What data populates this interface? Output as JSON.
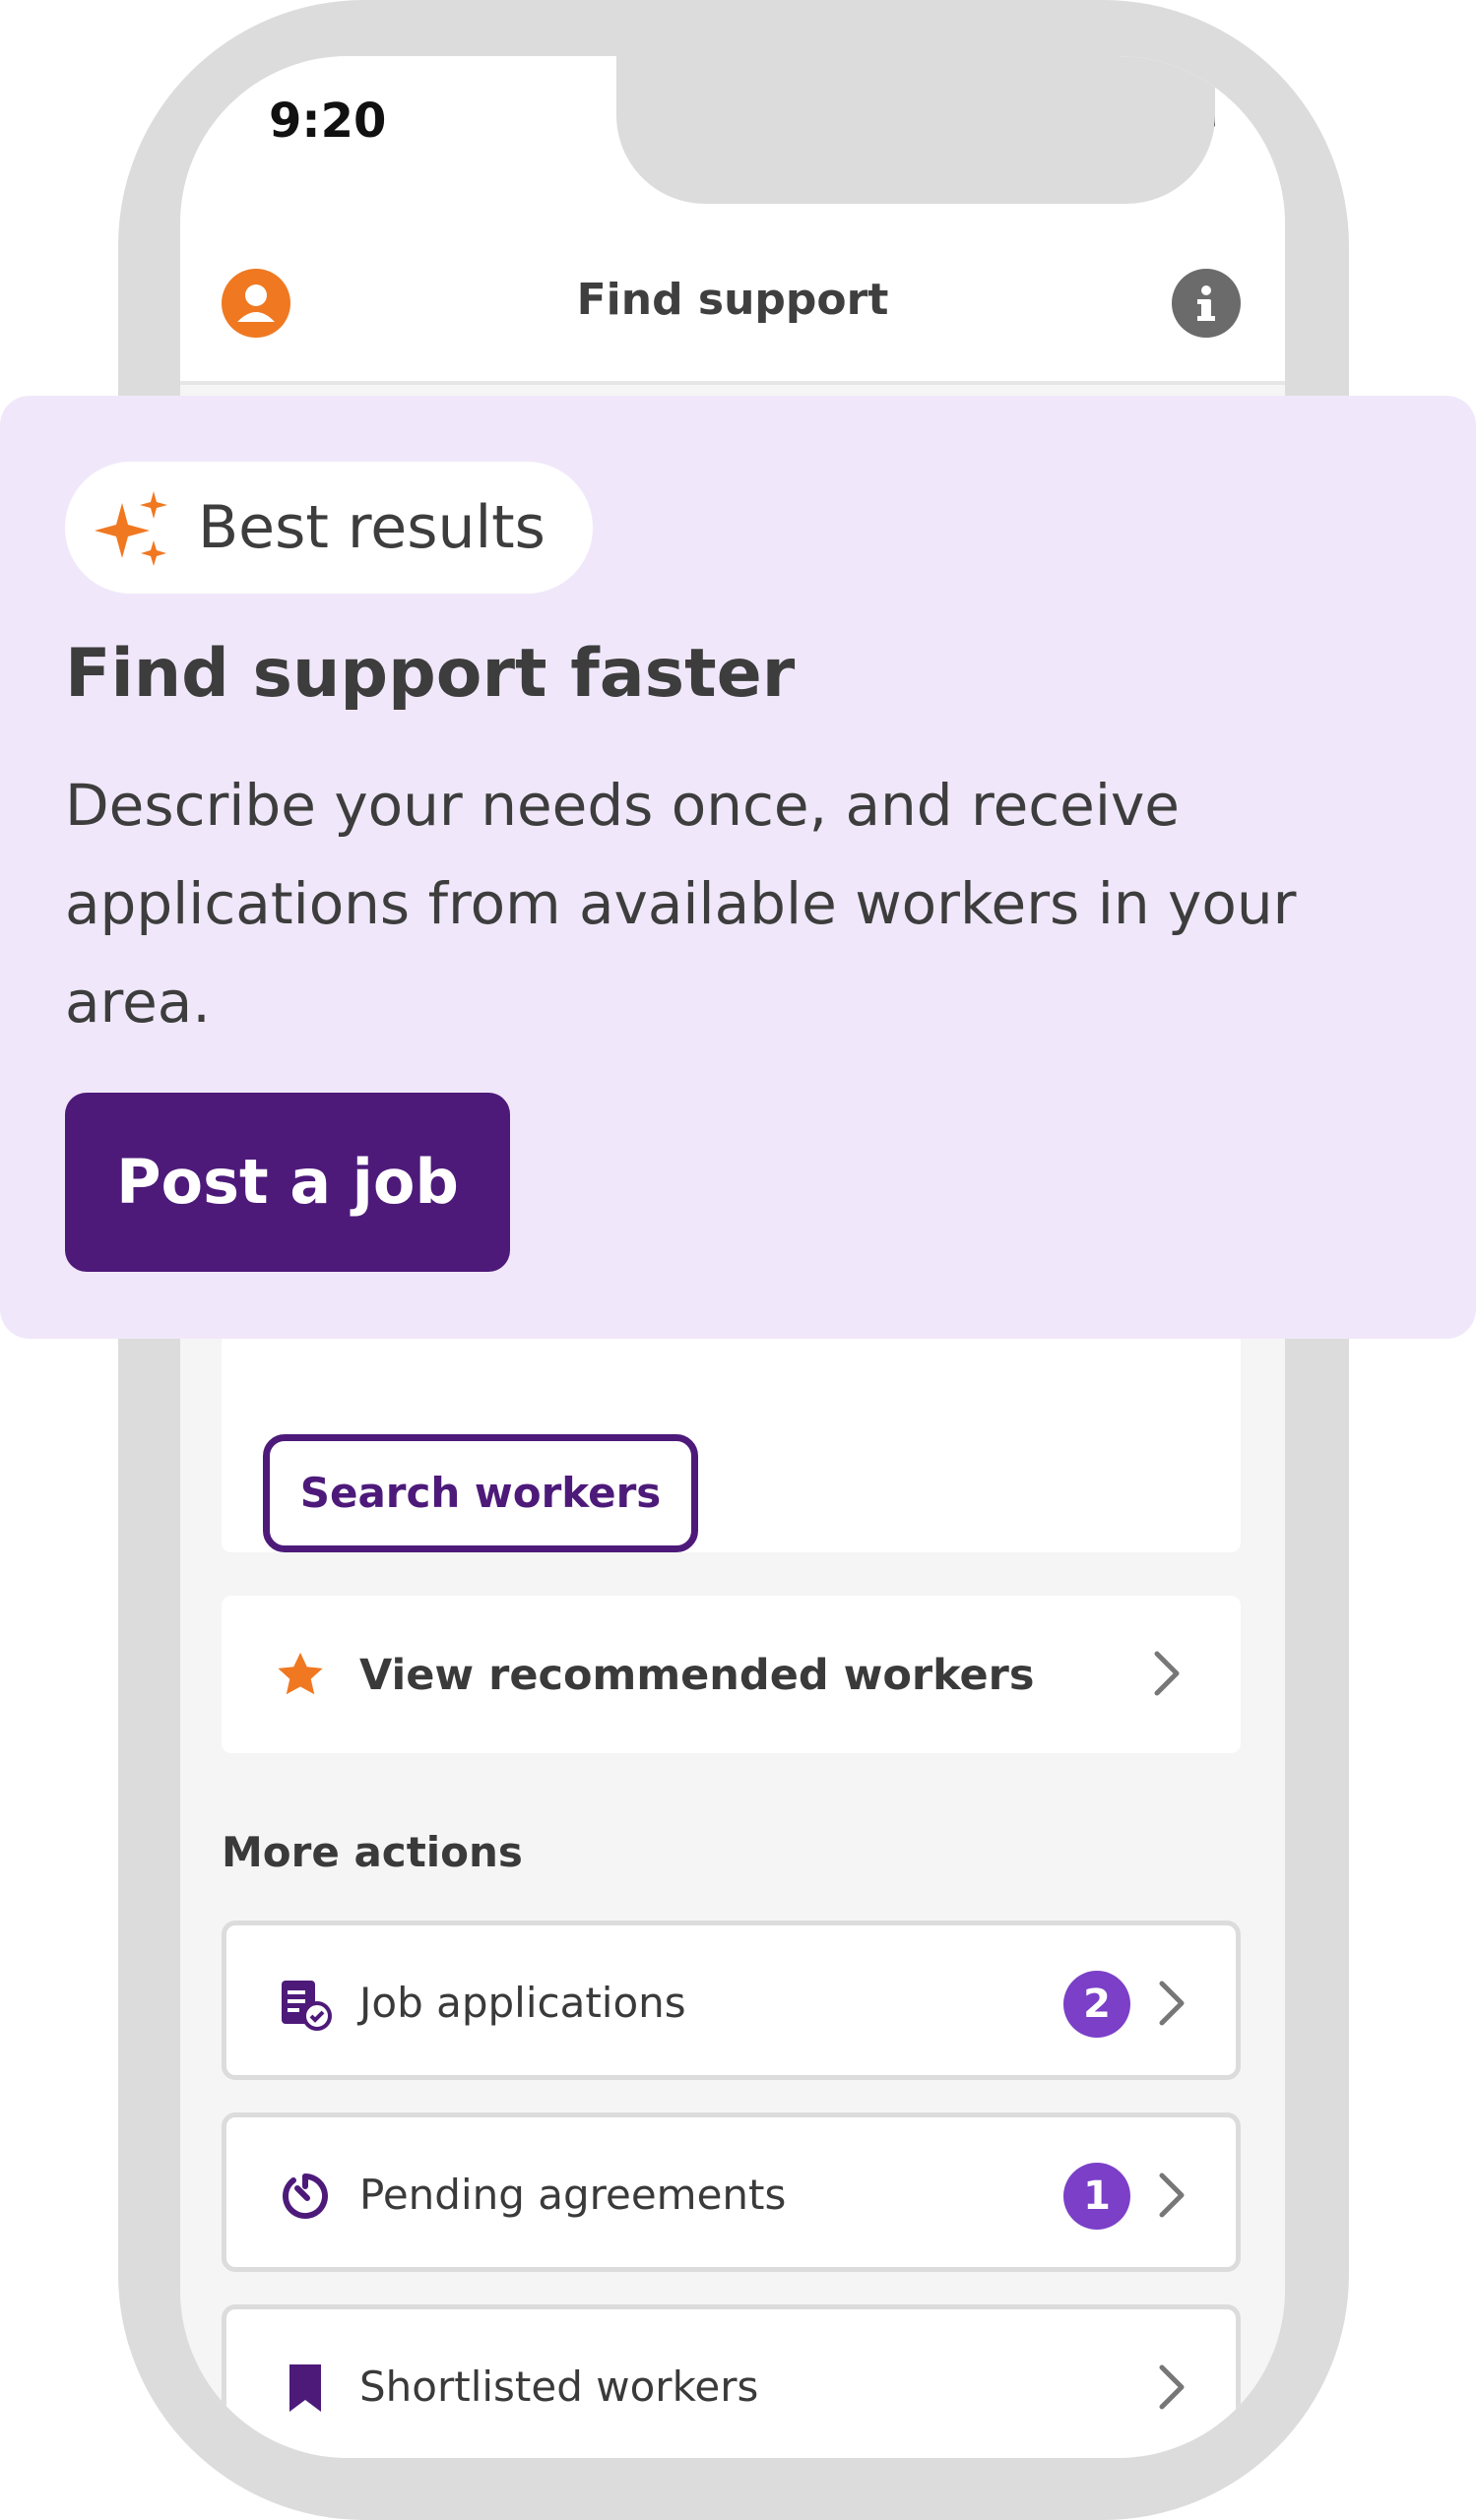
{
  "status_bar": {
    "time": "9:20"
  },
  "nav": {
    "title": "Find support"
  },
  "promo": {
    "pill_label": "Best results",
    "heading": "Find support faster",
    "body": "Describe your needs once, and receive applications from available workers in your area.",
    "button_label": "Post a job"
  },
  "search": {
    "button_label": "Search workers"
  },
  "recommended": {
    "label": "View recommended workers"
  },
  "more_actions": {
    "heading": "More actions",
    "items": [
      {
        "label": "Job applications",
        "badge": "2",
        "icon": "document-check-icon"
      },
      {
        "label": "Pending agreements",
        "badge": "1",
        "icon": "timer-icon"
      },
      {
        "label": "Shortlisted workers",
        "icon": "bookmark-icon"
      }
    ]
  },
  "colors": {
    "brand_purple": "#4d1a7a",
    "accent_orange": "#f07821",
    "badge_purple": "#7b3fc8",
    "promo_bg": "#f0e8fa"
  }
}
